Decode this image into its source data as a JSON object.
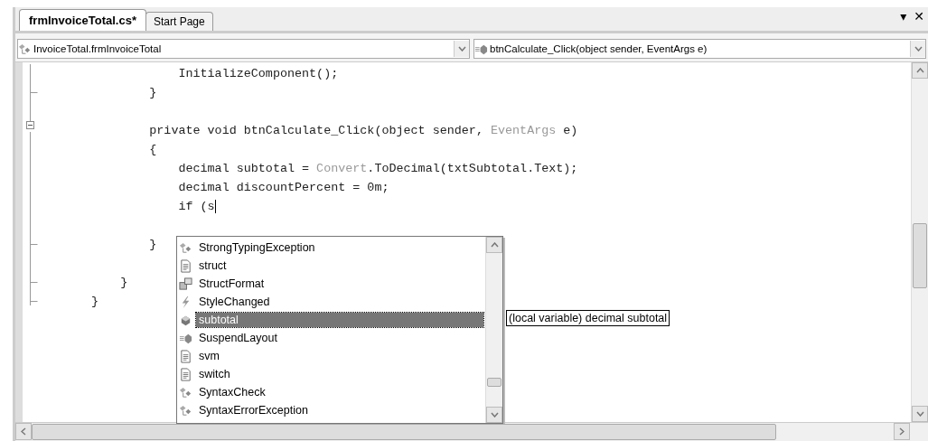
{
  "tabs": [
    {
      "label": "frmInvoiceTotal.cs*",
      "selected": true
    },
    {
      "label": "Start Page",
      "selected": false
    }
  ],
  "window_buttons": [
    "▾",
    "✕"
  ],
  "class_dropdown": {
    "value": "InvoiceTotal.frmInvoiceTotal"
  },
  "member_dropdown": {
    "value": "btnCalculate_Click(object sender, EventArgs e)"
  },
  "code_lines": [
    {
      "segments": [
        {
          "text": "            InitializeComponent();",
          "kind": "plain"
        }
      ]
    },
    {
      "segments": [
        {
          "text": "        }",
          "kind": "plain"
        }
      ]
    },
    {
      "kind": "blank"
    },
    {
      "segments": [
        {
          "text": "        private void btnCalculate_Click(object sender, ",
          "kind": "plain"
        },
        {
          "text": "EventArgs",
          "kind": "type"
        },
        {
          "text": " e)",
          "kind": "plain"
        }
      ]
    },
    {
      "segments": [
        {
          "text": "        {",
          "kind": "plain"
        }
      ]
    },
    {
      "segments": [
        {
          "text": "            decimal subtotal = ",
          "kind": "plain"
        },
        {
          "text": "Convert",
          "kind": "type"
        },
        {
          "text": ".ToDecimal(txtSubtotal.Text);",
          "kind": "plain"
        }
      ]
    },
    {
      "segments": [
        {
          "text": "            decimal discountPercent = 0m;",
          "kind": "plain"
        }
      ]
    },
    {
      "segments": [
        {
          "text": "            if (s",
          "kind": "plain"
        }
      ],
      "caret": true
    },
    {
      "kind": "blank"
    },
    {
      "segments": [
        {
          "text": "        }",
          "kind": "plain"
        }
      ]
    },
    {
      "kind": "blank"
    },
    {
      "segments": [
        {
          "text": "    }",
          "kind": "plain"
        }
      ]
    },
    {
      "segments": [
        {
          "text": "}",
          "kind": "plain"
        }
      ]
    }
  ],
  "completion_list": {
    "items": [
      {
        "label": "StrongTypingException",
        "kind": "class",
        "selected": false
      },
      {
        "label": "struct",
        "kind": "keyword",
        "selected": false
      },
      {
        "label": "StructFormat",
        "kind": "enum",
        "selected": false
      },
      {
        "label": "StyleChanged",
        "kind": "event",
        "selected": false
      },
      {
        "label": "subtotal",
        "kind": "variable",
        "selected": true
      },
      {
        "label": "SuspendLayout",
        "kind": "method",
        "selected": false
      },
      {
        "label": "svm",
        "kind": "keyword",
        "selected": false
      },
      {
        "label": "switch",
        "kind": "keyword",
        "selected": false
      },
      {
        "label": "SyntaxCheck",
        "kind": "class",
        "selected": false
      },
      {
        "label": "SyntaxErrorException",
        "kind": "class",
        "selected": false
      }
    ]
  },
  "tooltip": "(local variable) decimal subtotal"
}
